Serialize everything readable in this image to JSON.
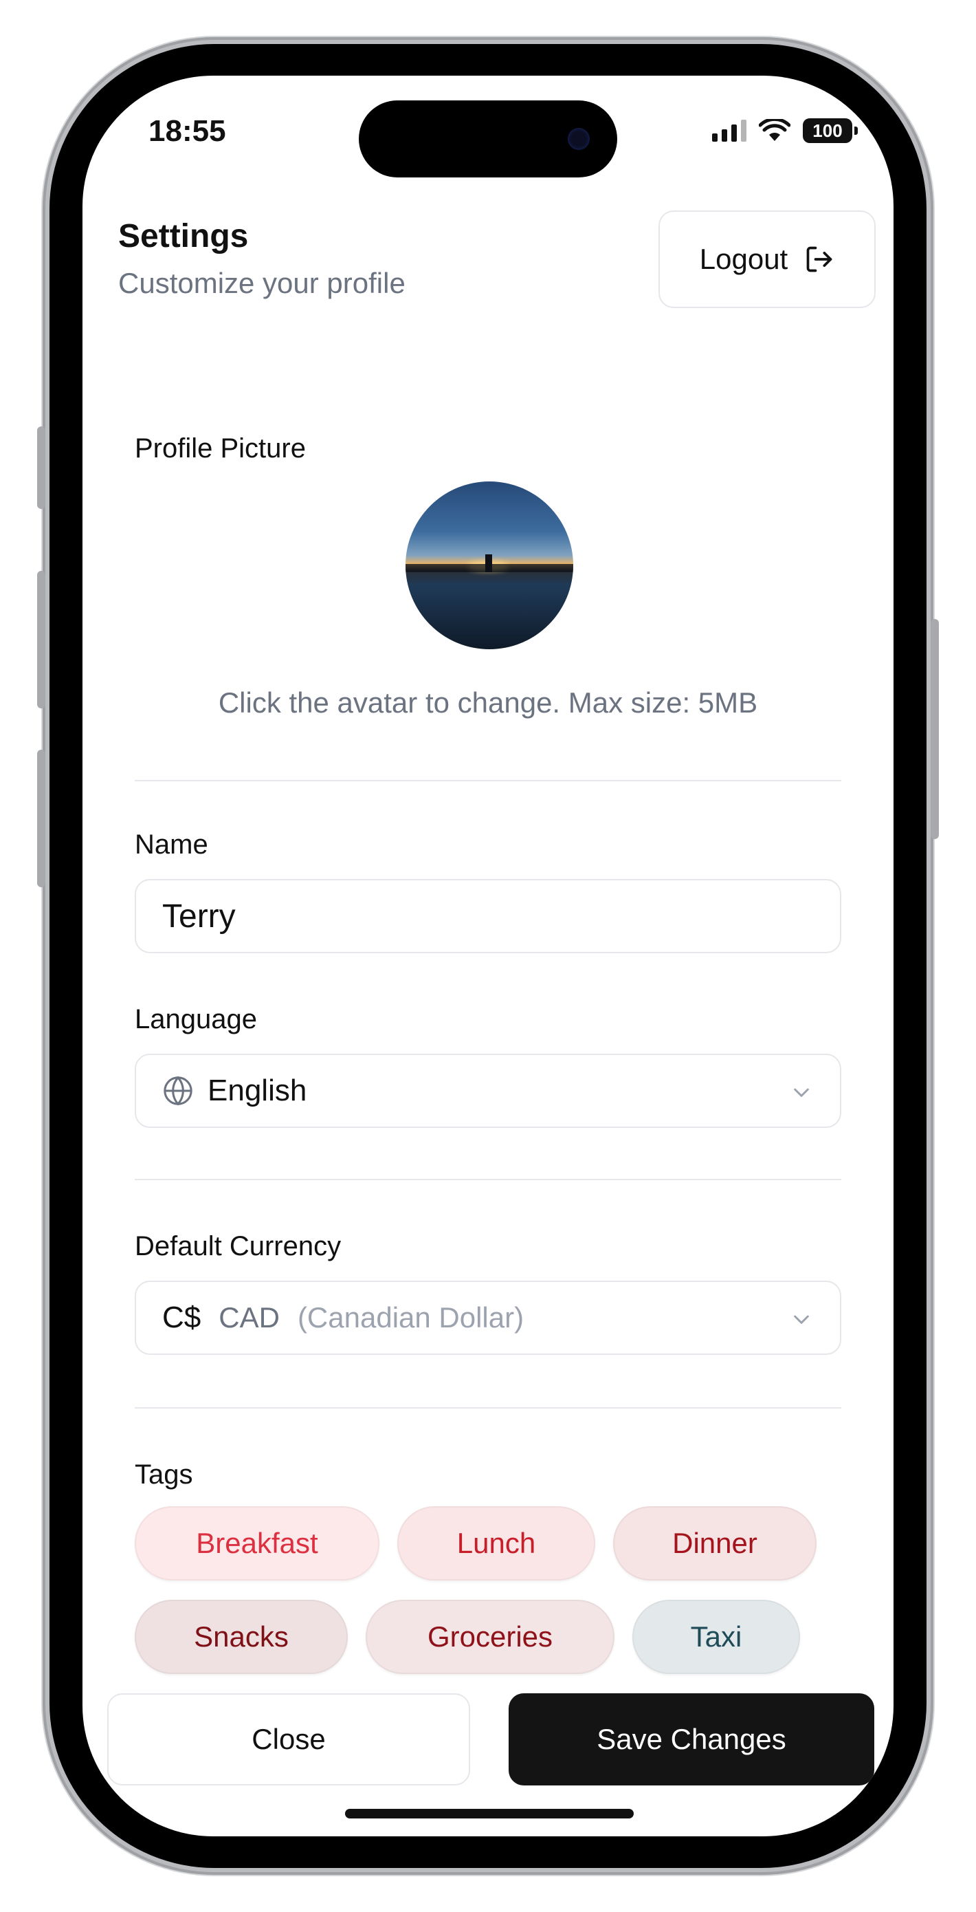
{
  "status_bar": {
    "time": "18:55",
    "battery": "100"
  },
  "header": {
    "title": "Settings",
    "subtitle": "Customize your profile",
    "logout_label": "Logout"
  },
  "profile_picture": {
    "label": "Profile Picture",
    "hint": "Click the avatar to change. Max size: 5MB"
  },
  "name_field": {
    "label": "Name",
    "value": "Terry"
  },
  "language_field": {
    "label": "Language",
    "value": "English",
    "icon": "globe-icon"
  },
  "currency_field": {
    "label": "Default Currency",
    "symbol": "C$",
    "code": "CAD",
    "name": "(Canadian Dollar)"
  },
  "tags": {
    "label": "Tags",
    "items": [
      {
        "label": "Breakfast",
        "bg": "#fde8ea",
        "fg": "#dc2f3f"
      },
      {
        "label": "Lunch",
        "bg": "#fbe6e7",
        "fg": "#c81e2a"
      },
      {
        "label": "Dinner",
        "bg": "#f6e3e4",
        "fg": "#a5131c"
      },
      {
        "label": "Snacks",
        "bg": "#efe1e2",
        "fg": "#7f1016"
      },
      {
        "label": "Groceries",
        "bg": "#f3e4e5",
        "fg": "#8f1119"
      },
      {
        "label": "Taxi",
        "bg": "#e3e9eb",
        "fg": "#1f4a57"
      }
    ]
  },
  "footer": {
    "close_label": "Close",
    "save_label": "Save Changes"
  },
  "colors": {
    "primary_button": "#141414",
    "muted_text": "#6b7280",
    "border": "#e5e7eb"
  }
}
